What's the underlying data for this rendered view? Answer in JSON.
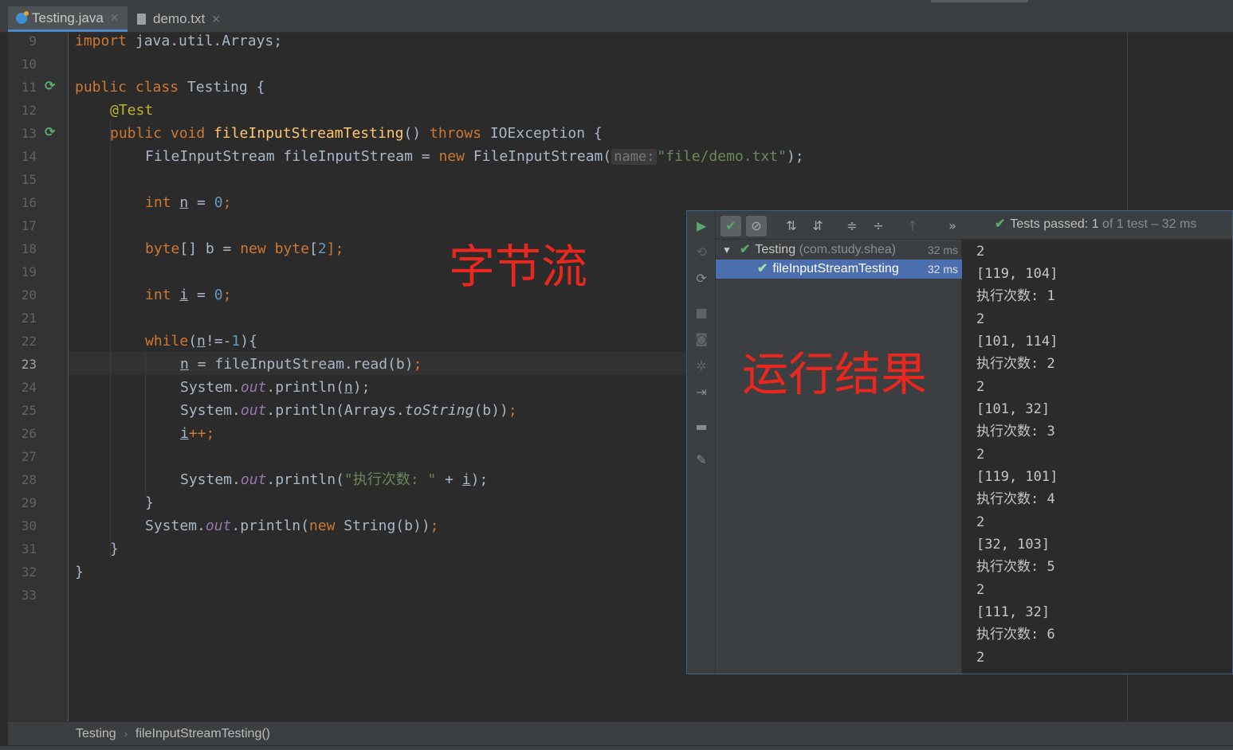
{
  "tabs": [
    {
      "label": "Testing.java",
      "active": true,
      "icon": "java-class-icon"
    },
    {
      "label": "demo.txt",
      "active": false,
      "icon": "text-file-icon"
    }
  ],
  "line_numbers": [
    "9",
    "10",
    "11",
    "12",
    "13",
    "14",
    "15",
    "16",
    "17",
    "18",
    "19",
    "20",
    "21",
    "22",
    "23",
    "24",
    "25",
    "26",
    "27",
    "28",
    "29",
    "30",
    "31",
    "32",
    "33"
  ],
  "current_line": "23",
  "code": {
    "l9": [
      "import",
      " java.util.Arrays;"
    ],
    "l11": [
      "public class ",
      "Testing {"
    ],
    "l12": "@Test",
    "l13": [
      "public void ",
      "fileInputStreamTesting",
      "() ",
      "throws ",
      "IOException {"
    ],
    "l14": [
      "FileInputStream fileInputStream = ",
      "new ",
      "FileInputStream(",
      "name:",
      "\"file/demo.txt\"",
      ");"
    ],
    "l16": [
      "int ",
      "n",
      " = ",
      "0",
      ";"
    ],
    "l18": [
      "byte",
      "[] b = ",
      "new ",
      "byte",
      "[",
      "2",
      "];"
    ],
    "l20": [
      "int ",
      "i",
      " = ",
      "0",
      ";"
    ],
    "l22": [
      "while",
      "(",
      "n",
      "!=-",
      "1",
      "){"
    ],
    "l23": [
      "n",
      " = fileInputStream.read(b)",
      ";"
    ],
    "l24": [
      "System.",
      "out",
      ".println(",
      "n",
      ");"
    ],
    "l25": [
      "System.",
      "out",
      ".println(Arrays.",
      "toString",
      "(b))",
      ";"
    ],
    "l26": [
      "i",
      "++;"
    ],
    "l28": [
      "System.",
      "out",
      ".println(",
      "\"执行次数: \"",
      " + ",
      "i",
      ");"
    ],
    "l29": "}",
    "l30": [
      "System.",
      "out",
      ".println(",
      "new ",
      "String(b))",
      ";"
    ],
    "l31": "}",
    "l32": "}"
  },
  "annotations": {
    "byte_stream": "字节流",
    "run_result": "运行结果"
  },
  "run_panel": {
    "status_prefix": "Tests passed:",
    "status_count": "1",
    "status_suffix": "of 1 test – 32 ms",
    "tree": [
      {
        "name": "Testing",
        "pkg": "(com.study.shea)",
        "time": "32 ms"
      },
      {
        "name": "fileInputStreamTesting",
        "time": "32 ms"
      }
    ],
    "console": [
      "2",
      "[119, 104]",
      "执行次数: 1",
      "2",
      "[101, 114]",
      "执行次数: 2",
      "2",
      "[101, 32]",
      "执行次数: 3",
      "2",
      "[119, 101]",
      "执行次数: 4",
      "2",
      "[32, 103]",
      "执行次数: 5",
      "2",
      "[111, 32]",
      "执行次数: 6",
      "2"
    ]
  },
  "breadcrumb": [
    "Testing",
    "fileInputStreamTesting()"
  ],
  "colors": {
    "keyword": "#cc7832",
    "annotation": "#bbb529",
    "method_decl": "#ffc66d",
    "number": "#6897bb",
    "string": "#6a8759",
    "static_field": "#9876aa",
    "overlay_red": "#e8271e",
    "pass_green": "#59a869",
    "selection_blue": "#4b6eaf"
  }
}
